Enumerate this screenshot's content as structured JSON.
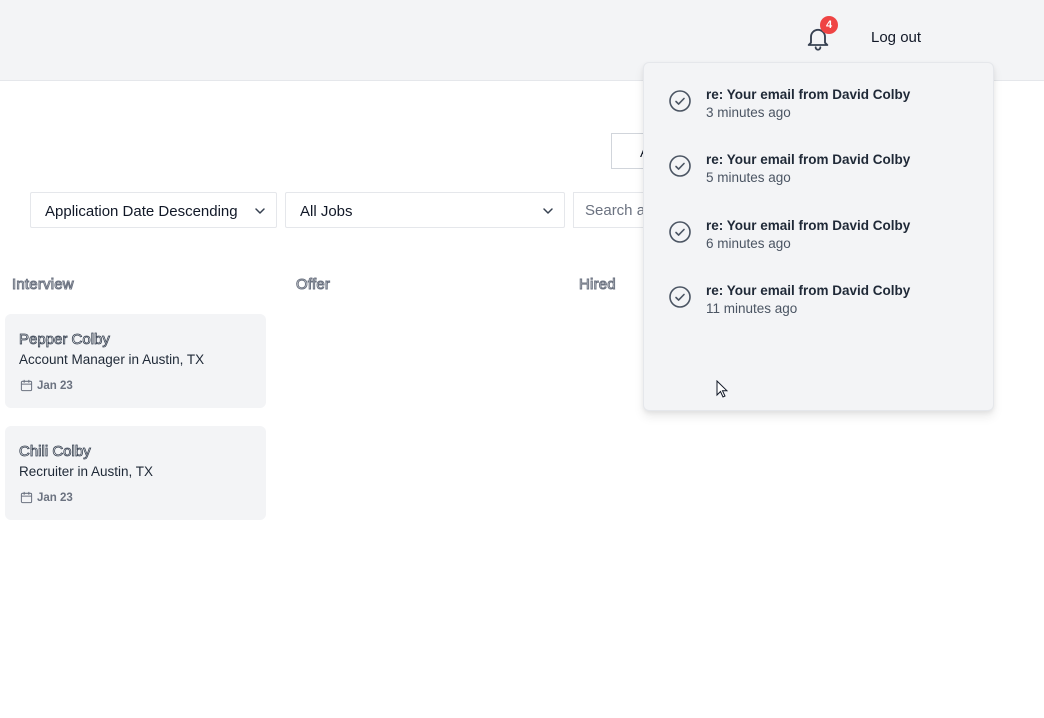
{
  "header": {
    "notification_count": "4",
    "logout_label": "Log out"
  },
  "toolbar": {
    "partial_button_label": "A"
  },
  "filters": {
    "sort_value": "Application Date Descending",
    "jobs_value": "All Jobs",
    "search_placeholder": "Search applicants"
  },
  "board": {
    "columns": [
      {
        "title": "Interview"
      },
      {
        "title": "Offer"
      },
      {
        "title": "Hired"
      }
    ],
    "cards": [
      {
        "name": "Pepper Colby",
        "role": "Account Manager in Austin, TX",
        "date": "Jan 23"
      },
      {
        "name": "Chili Colby",
        "role": "Recruiter in Austin, TX",
        "date": "Jan 23"
      }
    ]
  },
  "notifications": [
    {
      "title": "re: Your email from David Colby",
      "time": "3 minutes ago"
    },
    {
      "title": "re: Your email from David Colby",
      "time": "5 minutes ago"
    },
    {
      "title": "re: Your email from David Colby",
      "time": "6 minutes ago"
    },
    {
      "title": "re: Your email from David Colby",
      "time": "11 minutes ago"
    }
  ],
  "colors": {
    "topbar_bg": "#f3f4f6",
    "badge": "#ef4444",
    "card_bg": "#f3f4f6"
  },
  "icons": {
    "bell": "bell-icon",
    "check": "check-circle-icon",
    "calendar": "calendar-icon",
    "chevron": "chevron-down-icon"
  }
}
